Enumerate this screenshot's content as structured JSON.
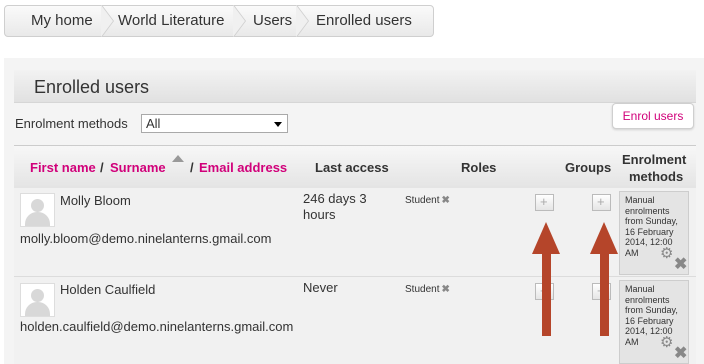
{
  "breadcrumb": [
    "My home",
    "World Literature",
    "Users",
    "Enrolled users"
  ],
  "page": {
    "heading": "Enrolled users",
    "enrol_button": "Enrol users"
  },
  "filter": {
    "label": "Enrolment methods",
    "selected": "All"
  },
  "table": {
    "headers": {
      "first_name": "First name",
      "slash1": "/",
      "surname": "Surname",
      "slash2": "/",
      "email": "Email address",
      "last_access": "Last access",
      "roles": "Roles",
      "groups": "Groups",
      "enrolment_line1": "Enrolment",
      "enrolment_line2": "methods"
    },
    "rows": [
      {
        "name": "Molly Bloom",
        "email": "molly.bloom@demo.ninelanterns.gmail.com",
        "last_access_1": "246 days 3",
        "last_access_2": "hours",
        "role": "Student",
        "enrolment": "Manual enrolments from Sunday, 16 February 2014, 12:00 AM"
      },
      {
        "name": "Holden Caulfield",
        "email": "holden.caulfield@demo.ninelanterns.gmail.com",
        "last_access_1": "Never",
        "last_access_2": "",
        "role": "Student",
        "enrolment": "Manual enrolments from Sunday, 16 February 2014, 12:00 AM"
      }
    ]
  },
  "colors": {
    "link": "#d1007a",
    "annotation_arrow": "#b5452a"
  },
  "icons": [
    "remove-role-icon",
    "add-role-icon",
    "add-group-icon",
    "gear-icon",
    "unenrol-icon",
    "sort-ascending-icon",
    "user-avatar"
  ]
}
